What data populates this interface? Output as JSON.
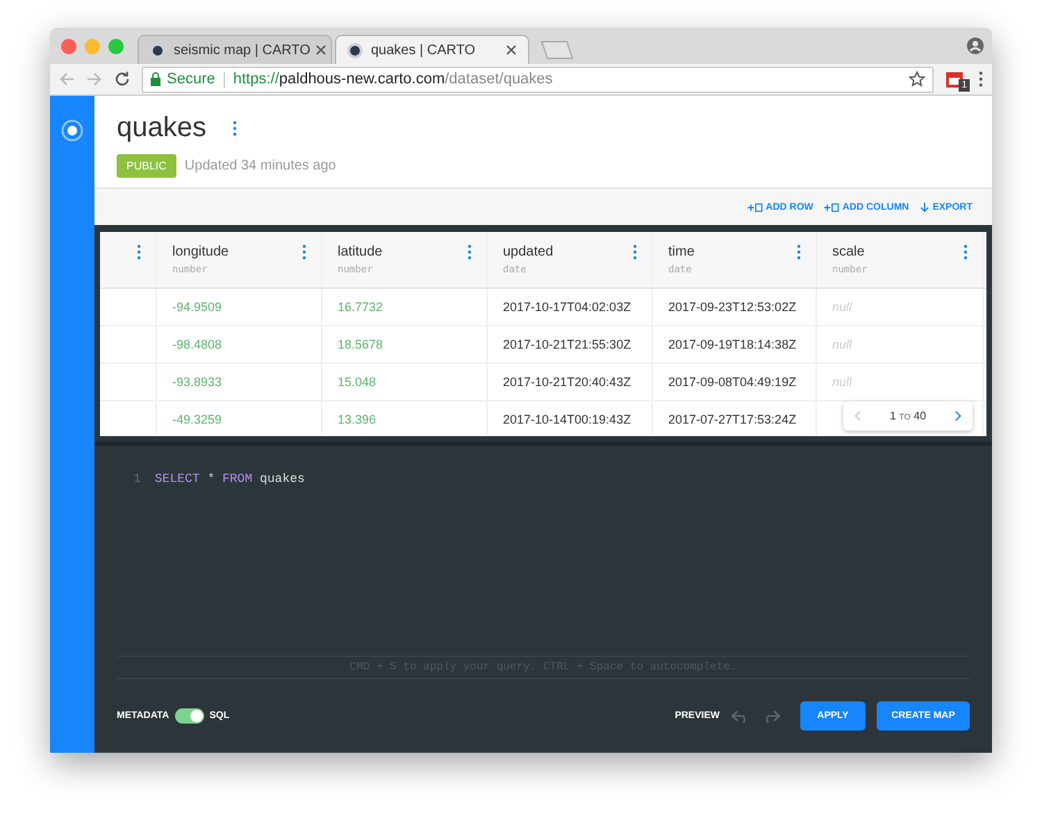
{
  "browser": {
    "tabs": [
      {
        "title": "seismic map | CARTO",
        "selected": false
      },
      {
        "title": "quakes | CARTO",
        "selected": true
      }
    ],
    "address": {
      "secure_label": "Secure",
      "scheme": "https://",
      "host": "paldhous-new.carto.com",
      "path": "/dataset/quakes"
    },
    "extension_badge": "1"
  },
  "dataset": {
    "title": "quakes",
    "badge": "PUBLIC",
    "updated": "Updated 34 minutes ago"
  },
  "actions": [
    "ADD ROW",
    "ADD COLUMN",
    "EXPORT"
  ],
  "table": {
    "columns": [
      {
        "name": "longitude",
        "type": "number"
      },
      {
        "name": "latitude",
        "type": "number"
      },
      {
        "name": "updated",
        "type": "date"
      },
      {
        "name": "time",
        "type": "date"
      },
      {
        "name": "scale",
        "type": "number"
      }
    ],
    "rows": [
      [
        {
          "text": "-94.9509",
          "kind": "number"
        },
        {
          "text": "16.7732",
          "kind": "number"
        },
        {
          "text": "2017-10-17T04:02:03Z",
          "kind": "date"
        },
        {
          "text": "2017-09-23T12:53:02Z",
          "kind": "date"
        },
        {
          "text": "null",
          "kind": "null"
        }
      ],
      [
        {
          "text": "-98.4808",
          "kind": "number"
        },
        {
          "text": "18.5678",
          "kind": "number"
        },
        {
          "text": "2017-10-21T21:55:30Z",
          "kind": "date"
        },
        {
          "text": "2017-09-19T18:14:38Z",
          "kind": "date"
        },
        {
          "text": "null",
          "kind": "null"
        }
      ],
      [
        {
          "text": "-93.8933",
          "kind": "number"
        },
        {
          "text": "15.048",
          "kind": "number"
        },
        {
          "text": "2017-10-21T20:40:43Z",
          "kind": "date"
        },
        {
          "text": "2017-09-08T04:49:19Z",
          "kind": "date"
        },
        {
          "text": "null",
          "kind": "null"
        }
      ],
      [
        {
          "text": "-49.3259",
          "kind": "number"
        },
        {
          "text": "13.396",
          "kind": "number"
        },
        {
          "text": "2017-10-14T00:19:43Z",
          "kind": "date"
        },
        {
          "text": "2017-07-27T17:53:24Z",
          "kind": "date"
        }
      ]
    ],
    "pagination": {
      "from": "1",
      "to_label": "TO",
      "to": "40"
    }
  },
  "editor": {
    "line_number": "1",
    "tokens": [
      {
        "text": "SELECT",
        "kind": "keyword"
      },
      {
        "text": "*",
        "kind": "operator"
      },
      {
        "text": "FROM",
        "kind": "keyword"
      },
      {
        "text": "quakes",
        "kind": "identifier"
      }
    ],
    "hint": "CMD + S to apply your query. CTRL + Space to autocomplete."
  },
  "footer": {
    "left_label": "METADATA",
    "right_label": "SQL",
    "toggle_on": true,
    "preview": "PREVIEW",
    "buttons": [
      "APPLY",
      "CREATE MAP"
    ]
  }
}
